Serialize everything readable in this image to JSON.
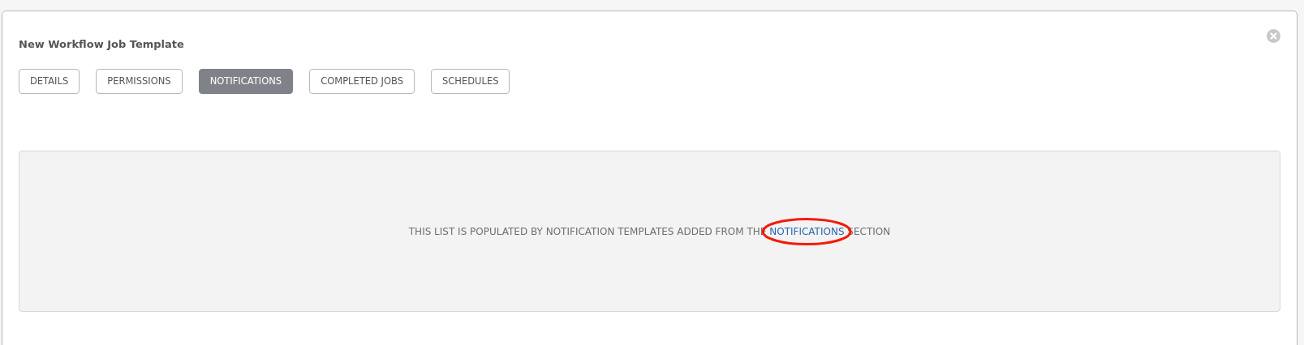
{
  "panel": {
    "title": "New Workflow Job Template"
  },
  "tabs": [
    {
      "label": "DETAILS",
      "selected": false
    },
    {
      "label": "PERMISSIONS",
      "selected": false
    },
    {
      "label": "NOTIFICATIONS",
      "selected": true
    },
    {
      "label": "COMPLETED JOBS",
      "selected": false
    },
    {
      "label": "SCHEDULES",
      "selected": false
    }
  ],
  "empty_message": {
    "before": "THIS LIST IS POPULATED BY NOTIFICATION TEMPLATES ADDED FROM THE",
    "link": "NOTIFICATIONS",
    "after": "SECTION",
    "link_circled": true
  }
}
